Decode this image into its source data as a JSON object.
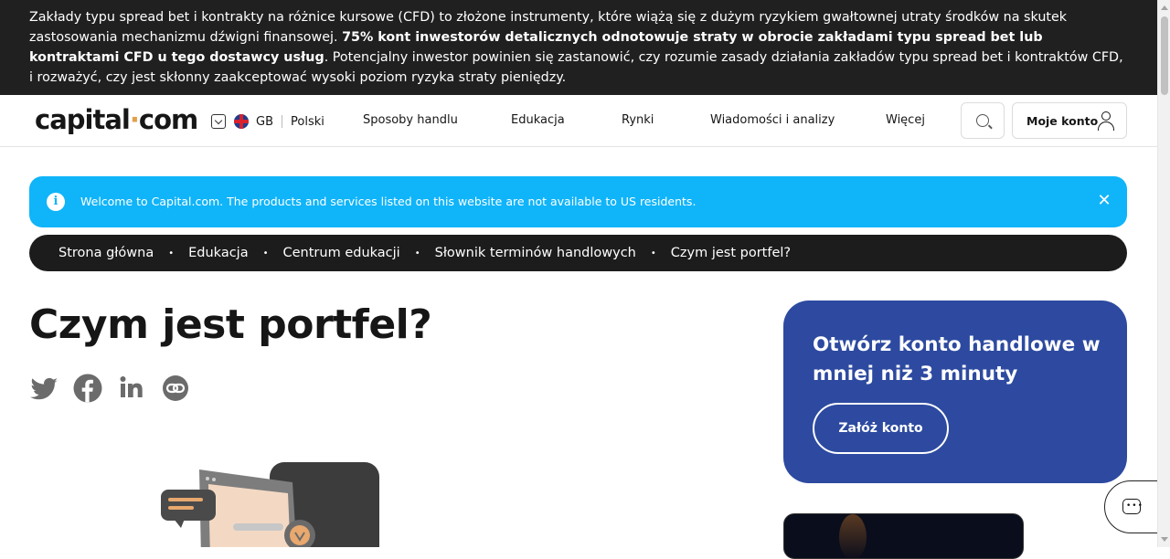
{
  "risk_warning": {
    "text_before": "Zakłady typu spread bet i kontrakty na różnice kursowe (CFD) to złożone instrumenty, które wiążą się z dużym ryzykiem gwałtownej utraty środków na skutek zastosowania mechanizmu dźwigni finansowej. ",
    "bold_text": "75% kont inwestorów detalicznych odnotowuje straty w obrocie zakładami typu spread bet lub kontraktami CFD u tego dostawcy usług",
    "text_after": ". Potencjalny inwestor powinien się zastanowić, czy rozumie zasady działania zakładów typu spread bet i kontraktów CFD, i rozważyć, czy jest skłonny zaakceptować wysoki poziom ryzyka straty pieniędzy."
  },
  "header": {
    "logo_part1": "capital",
    "logo_dot": "·",
    "logo_part2": "com",
    "region": "GB",
    "language": "Polski",
    "nav": [
      "Sposoby handlu",
      "Edukacja",
      "Rynki",
      "Wiadomości i analizy",
      "Więcej"
    ],
    "account_label": "Moje konto"
  },
  "notice": {
    "text": "Welcome to Capital.com. The products and services listed on this website are not available to US residents.",
    "info_glyph": "i",
    "close_glyph": "✕"
  },
  "breadcrumb": [
    "Strona główna",
    "Edukacja",
    "Centrum edukacji",
    "Słownik terminów handlowych",
    "Czym jest portfel?"
  ],
  "breadcrumb_separator": "•",
  "page": {
    "title": "Czym jest portfel?"
  },
  "share_icons": [
    "twitter-icon",
    "facebook-icon",
    "linkedin-icon",
    "link-icon"
  ],
  "cta": {
    "title": "Otwórz konto handlowe w mniej niż 3 minuty",
    "button": "Załóż konto"
  },
  "colors": {
    "risk_bg": "#202020",
    "notice_bg": "#10b4f9",
    "breadcrumb_bg": "#1c1c1c",
    "cta_bg": "#2d4aa0",
    "icon_gray": "#6b6b6b",
    "logo_dot": "#e2a04b"
  }
}
